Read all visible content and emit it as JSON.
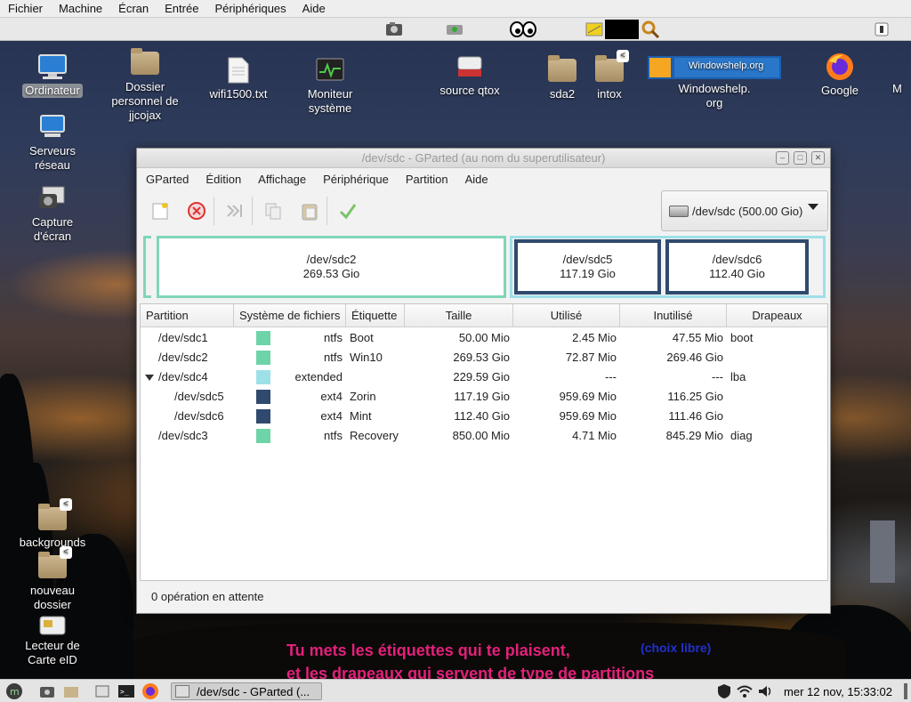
{
  "vbox_menu": [
    "Fichier",
    "Machine",
    "Écran",
    "Entrée",
    "Périphériques",
    "Aide"
  ],
  "desktop_icons": [
    {
      "label": "Ordinateur",
      "icon": "computer-icon",
      "selected": true
    },
    {
      "label": "Dossier personnel de jjcojax",
      "icon": "home-folder-icon"
    },
    {
      "label": "wifi1500.txt",
      "icon": "text-file-icon"
    },
    {
      "label": "Moniteur système",
      "icon": "system-monitor-icon"
    },
    {
      "label": "source qtox",
      "icon": "qtox-icon"
    },
    {
      "label": "sda2",
      "icon": "folder-icon"
    },
    {
      "label": "intox",
      "icon": "shared-folder-icon"
    },
    {
      "label": "Windowshelp. org",
      "icon": "windowshelp-icon"
    },
    {
      "label": "Google",
      "icon": "firefox-icon"
    },
    {
      "label": "M",
      "icon": "partial-icon"
    },
    {
      "label": "Serveurs réseau",
      "icon": "network-servers-icon"
    },
    {
      "label": "Capture d'écran",
      "icon": "screenshot-icon"
    },
    {
      "label": "backgrounds",
      "icon": "shared-folder-icon"
    },
    {
      "label": "nouveau dossier",
      "icon": "shared-folder-icon"
    },
    {
      "label": "Lecteur de Carte eID",
      "icon": "card-reader-icon"
    }
  ],
  "window": {
    "title": "/dev/sdc - GParted (au nom du superutilisateur)",
    "menu": [
      "GParted",
      "Édition",
      "Affichage",
      "Périphérique",
      "Partition",
      "Aide"
    ],
    "device": "/dev/sdc  (500.00 Gio)",
    "graph": [
      {
        "name": "/dev/sdc2",
        "size": "269.53 Gio"
      },
      {
        "name": "/dev/sdc5",
        "size": "117.19 Gio"
      },
      {
        "name": "/dev/sdc6",
        "size": "112.40 Gio"
      }
    ],
    "columns": [
      "Partition",
      "Système de fichiers",
      "Étiquette",
      "Taille",
      "Utilisé",
      "Inutilisé",
      "Drapeaux"
    ],
    "rows": [
      {
        "partition": "/dev/sdc1",
        "fs": "ntfs",
        "color": "#6fd3a8",
        "label": "Boot",
        "size": "50.00 Mio",
        "used": "2.45 Mio",
        "unused": "47.55 Mio",
        "flags": "boot",
        "indent": 0
      },
      {
        "partition": "/dev/sdc2",
        "fs": "ntfs",
        "color": "#6fd3a8",
        "label": "Win10",
        "size": "269.53 Gio",
        "used": "72.87 Mio",
        "unused": "269.46 Gio",
        "flags": "",
        "indent": 0
      },
      {
        "partition": "/dev/sdc4",
        "fs": "extended",
        "color": "#9ee0e8",
        "label": "",
        "size": "229.59 Gio",
        "used": "---",
        "unused": "---",
        "flags": "lba",
        "indent": 0,
        "expander": true
      },
      {
        "partition": "/dev/sdc5",
        "fs": "ext4",
        "color": "#2f4a6e",
        "label": "Zorin",
        "size": "117.19 Gio",
        "used": "959.69 Mio",
        "unused": "116.25 Gio",
        "flags": "",
        "indent": 1
      },
      {
        "partition": "/dev/sdc6",
        "fs": "ext4",
        "color": "#2f4a6e",
        "label": "Mint",
        "size": "112.40 Gio",
        "used": "959.69 Mio",
        "unused": "111.46 Gio",
        "flags": "",
        "indent": 1
      },
      {
        "partition": "/dev/sdc3",
        "fs": "ntfs",
        "color": "#6fd3a8",
        "label": "Recovery",
        "size": "850.00 Mio",
        "used": "4.71 Mio",
        "unused": "845.29 Mio",
        "flags": "diag",
        "indent": 0
      }
    ],
    "note_line1": "Tu mets les étiquettes qui te plaisent,",
    "note_line2": "et les drapeaux qui servent de type de partitions",
    "note_aside": "(choix libre)",
    "status": "0 opération en attente"
  },
  "taskbar": {
    "task_label": "/dev/sdc - GParted (...",
    "clock": "mer 12 nov, 15:33:02"
  },
  "colors": {
    "ntfs": "#6fd3a8",
    "ext4": "#2f4a6e",
    "extended": "#9ee0e8",
    "accent_text": "#e4207a",
    "aside_text": "#2030d0"
  }
}
